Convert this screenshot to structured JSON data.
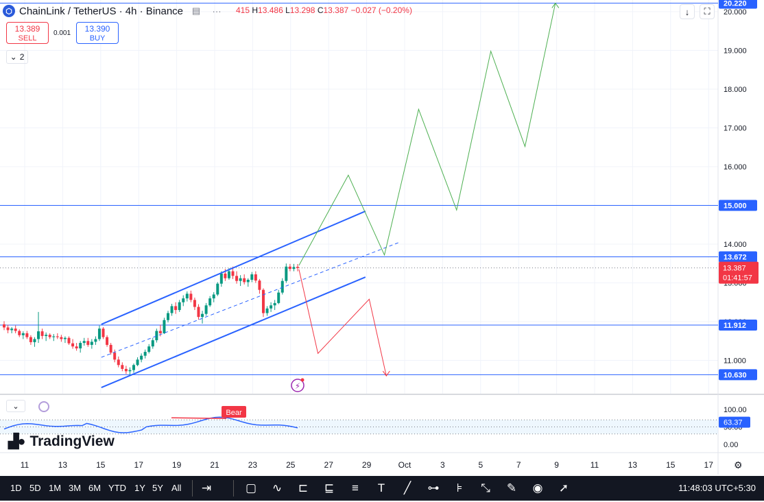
{
  "header": {
    "symbol": "ChainLink / TetherUS · 4h · Binance",
    "ohlc_prefix": "415",
    "high_label": "H",
    "high": "13.486",
    "low_label": "L",
    "low": "13.298",
    "close_label": "C",
    "close": "13.387",
    "change": "−0.027 (−0.20%)"
  },
  "trade": {
    "sell_price": "13.389",
    "sell_label": "SELL",
    "spread": "0.001",
    "buy_price": "13.390",
    "buy_label": "BUY"
  },
  "legend_count": "2",
  "brand": "TradingView",
  "ranges": [
    "1D",
    "5D",
    "1M",
    "3M",
    "6M",
    "YTD",
    "1Y",
    "5Y",
    "All"
  ],
  "clock": "11:48:03 UTC+5:30",
  "colors": {
    "up": "#089981",
    "down": "#f23645",
    "channel": "#2962ff",
    "level": "#2962ff",
    "bull_path": "#4caf50",
    "bear_path": "#f23645",
    "rsi": "#2962ff"
  },
  "chart_data": {
    "type": "candlestick",
    "price_axis": {
      "min": 10.4,
      "max": 20.2,
      "ticks": [
        "11.000",
        "12.000",
        "13.000",
        "14.000",
        "15.000",
        "16.000",
        "17.000",
        "18.000",
        "19.000",
        "20.000"
      ]
    },
    "x_ticks": [
      "11",
      "13",
      "15",
      "17",
      "19",
      "21",
      "23",
      "25",
      "27",
      "29",
      "Oct",
      "3",
      "5",
      "7",
      "9",
      "11",
      "13",
      "15",
      "17"
    ],
    "levels": [
      {
        "value": 20.22,
        "label": "20.220"
      },
      {
        "value": 15.0,
        "label": "15.000"
      },
      {
        "value": 13.672,
        "label": "13.672"
      },
      {
        "value": 11.912,
        "label": "11.912"
      },
      {
        "value": 10.63,
        "label": "10.630"
      }
    ],
    "last_price": {
      "value": "13.387",
      "countdown": "01:41:57"
    },
    "ohlc": [
      [
        11.93,
        12.01,
        11.78,
        11.85
      ],
      [
        11.85,
        11.92,
        11.7,
        11.78
      ],
      [
        11.78,
        11.86,
        11.7,
        11.82
      ],
      [
        11.82,
        11.9,
        11.7,
        11.76
      ],
      [
        11.76,
        11.8,
        11.6,
        11.65
      ],
      [
        11.65,
        11.75,
        11.55,
        11.7
      ],
      [
        11.7,
        11.76,
        11.55,
        11.6
      ],
      [
        11.6,
        11.65,
        11.4,
        11.47
      ],
      [
        11.47,
        11.6,
        11.35,
        11.55
      ],
      [
        11.55,
        12.25,
        11.45,
        11.75
      ],
      [
        11.75,
        11.82,
        11.55,
        11.63
      ],
      [
        11.63,
        11.72,
        11.5,
        11.66
      ],
      [
        11.66,
        11.7,
        11.55,
        11.6
      ],
      [
        11.6,
        11.68,
        11.5,
        11.62
      ],
      [
        11.62,
        11.7,
        11.55,
        11.6
      ],
      [
        11.6,
        11.66,
        11.48,
        11.55
      ],
      [
        11.55,
        11.62,
        11.45,
        11.58
      ],
      [
        11.58,
        11.62,
        11.4,
        11.44
      ],
      [
        11.44,
        11.55,
        11.3,
        11.36
      ],
      [
        11.36,
        11.45,
        11.25,
        11.31
      ],
      [
        11.31,
        11.5,
        11.2,
        11.45
      ],
      [
        11.45,
        11.58,
        11.38,
        11.5
      ],
      [
        11.5,
        11.58,
        11.35,
        11.4
      ],
      [
        11.4,
        11.55,
        11.3,
        11.48
      ],
      [
        11.48,
        11.62,
        11.4,
        11.55
      ],
      [
        11.55,
        11.9,
        11.5,
        11.82
      ],
      [
        11.82,
        11.86,
        11.55,
        11.6
      ],
      [
        11.6,
        11.65,
        11.35,
        11.4
      ],
      [
        11.4,
        11.45,
        11.15,
        11.2
      ],
      [
        11.2,
        11.28,
        10.95,
        11.02
      ],
      [
        11.02,
        11.1,
        10.82,
        10.88
      ],
      [
        10.88,
        10.95,
        10.72,
        10.78
      ],
      [
        10.78,
        10.86,
        10.65,
        10.72
      ],
      [
        10.72,
        10.82,
        10.62,
        10.75
      ],
      [
        10.75,
        10.92,
        10.68,
        10.88
      ],
      [
        10.88,
        11.08,
        10.85,
        11.02
      ],
      [
        11.02,
        11.18,
        10.95,
        11.12
      ],
      [
        11.12,
        11.28,
        11.05,
        11.22
      ],
      [
        11.22,
        11.42,
        11.18,
        11.36
      ],
      [
        11.36,
        11.58,
        11.3,
        11.52
      ],
      [
        11.52,
        11.82,
        11.46,
        11.76
      ],
      [
        11.76,
        11.92,
        11.62,
        11.7
      ],
      [
        11.7,
        12.1,
        11.68,
        12.04
      ],
      [
        12.04,
        12.28,
        11.98,
        12.22
      ],
      [
        12.22,
        12.46,
        12.15,
        12.4
      ],
      [
        12.4,
        12.5,
        12.2,
        12.3
      ],
      [
        12.3,
        12.56,
        12.25,
        12.5
      ],
      [
        12.5,
        12.68,
        12.4,
        12.6
      ],
      [
        12.6,
        12.78,
        12.52,
        12.72
      ],
      [
        12.72,
        12.8,
        12.5,
        12.56
      ],
      [
        12.56,
        12.62,
        12.3,
        12.38
      ],
      [
        12.38,
        12.45,
        12.05,
        12.12
      ],
      [
        12.12,
        12.28,
        11.95,
        12.2
      ],
      [
        12.2,
        12.48,
        12.15,
        12.42
      ],
      [
        12.42,
        12.66,
        12.38,
        12.6
      ],
      [
        12.6,
        12.76,
        12.5,
        12.7
      ],
      [
        12.7,
        13.02,
        12.66,
        12.98
      ],
      [
        12.98,
        13.3,
        12.9,
        13.24
      ],
      [
        13.24,
        13.36,
        13.05,
        13.12
      ],
      [
        13.12,
        13.38,
        13.08,
        13.3
      ],
      [
        13.3,
        13.42,
        13.1,
        13.18
      ],
      [
        13.18,
        13.3,
        12.98,
        13.05
      ],
      [
        13.05,
        13.2,
        12.92,
        13.12
      ],
      [
        13.12,
        13.22,
        12.96,
        13.02
      ],
      [
        13.02,
        13.12,
        12.9,
        13.08
      ],
      [
        13.08,
        13.28,
        13.02,
        13.22
      ],
      [
        13.22,
        13.3,
        13.0,
        13.06
      ],
      [
        13.06,
        13.1,
        12.72,
        12.82
      ],
      [
        12.82,
        12.86,
        12.12,
        12.22
      ],
      [
        12.22,
        12.4,
        12.15,
        12.34
      ],
      [
        12.34,
        12.5,
        12.25,
        12.42
      ],
      [
        12.42,
        12.56,
        12.3,
        12.48
      ],
      [
        12.48,
        12.82,
        12.45,
        12.75
      ],
      [
        12.75,
        13.12,
        12.7,
        13.05
      ],
      [
        13.05,
        13.5,
        13.0,
        13.42
      ],
      [
        13.42,
        13.49,
        13.3,
        13.36
      ],
      [
        13.36,
        13.49,
        13.3,
        13.41
      ],
      [
        13.415,
        13.486,
        13.298,
        13.387
      ]
    ],
    "channel": {
      "upper": [
        [
          15.0,
          11.93
        ],
        [
          28.9,
          14.85
        ]
      ],
      "middle": [
        [
          15.0,
          11.08
        ],
        [
          30.7,
          14.05
        ]
      ],
      "lower": [
        [
          15.0,
          10.3
        ],
        [
          28.9,
          13.15
        ]
      ]
    },
    "projection_bull": [
      [
        25.4,
        13.45
      ],
      [
        28.0,
        15.78
      ],
      [
        29.9,
        13.72
      ],
      [
        31.7,
        17.48
      ],
      [
        33.7,
        14.88
      ],
      [
        35.5,
        18.98
      ],
      [
        37.3,
        16.52
      ],
      [
        38.9,
        20.22
      ]
    ],
    "projection_bear": [
      [
        25.4,
        13.35
      ],
      [
        26.4,
        11.18
      ],
      [
        29.1,
        12.58
      ],
      [
        30.0,
        10.6
      ]
    ],
    "rsi": {
      "axis": {
        "ticks": [
          "100.00",
          "50.00",
          "0.00"
        ]
      },
      "value": "63.37",
      "divergence_label": "Bear"
    }
  }
}
